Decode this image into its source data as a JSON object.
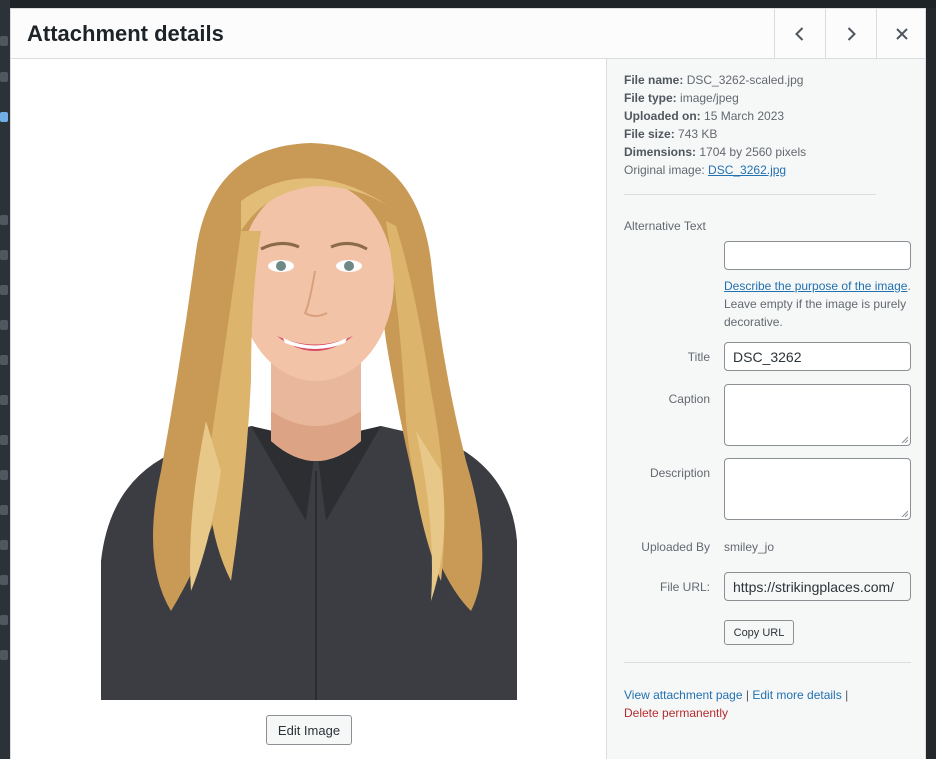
{
  "modal": {
    "title": "Attachment details"
  },
  "header_buttons": {
    "prev_icon": "chevron-left-icon",
    "next_icon": "chevron-right-icon",
    "close_icon": "close-icon"
  },
  "preview": {
    "edit_label": "Edit Image",
    "image": "portrait-photo"
  },
  "file_info": {
    "name_label": "File name:",
    "name_value": "DSC_3262-scaled.jpg",
    "type_label": "File type:",
    "type_value": "image/jpeg",
    "uploaded_label": "Uploaded on:",
    "uploaded_value": "15 March 2023",
    "size_label": "File size:",
    "size_value": "743 KB",
    "dimensions_label": "Dimensions:",
    "dimensions_value": "1704 by 2560 pixels",
    "original_label": "Original image:",
    "original_value": "DSC_3262.jpg"
  },
  "form": {
    "alt_label": "Alternative Text",
    "alt_value": "",
    "alt_help_link": "Describe the purpose of the image",
    "alt_help_text": ". Leave empty if the image is purely decorative.",
    "title_label": "Title",
    "title_value": "DSC_3262",
    "caption_label": "Caption",
    "caption_value": "",
    "description_label": "Description",
    "description_value": "",
    "uploaded_by_label": "Uploaded By",
    "uploaded_by_value": "smiley_jo",
    "file_url_label": "File URL:",
    "file_url_value": "https://strikingplaces.com/",
    "copy_url_label": "Copy URL"
  },
  "actions": {
    "view_label": "View attachment page",
    "sep": "|",
    "edit_label": "Edit more details",
    "delete_label": "Delete permanently"
  },
  "colors": {
    "link": "#2271b1",
    "delete": "#b32d2e",
    "sidebar_bg": "#f6f7f7"
  }
}
